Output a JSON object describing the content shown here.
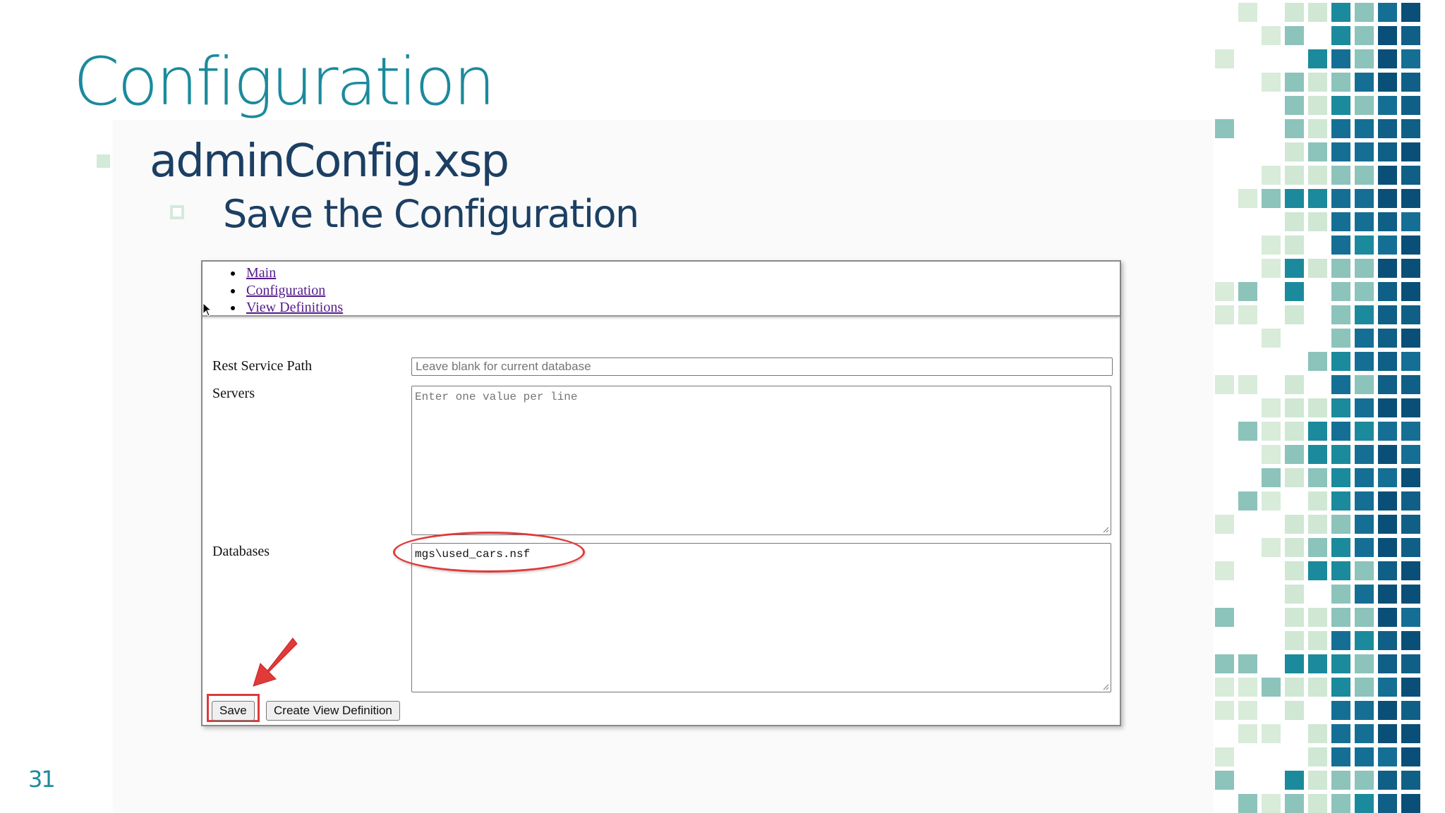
{
  "slide": {
    "title": "Configuration",
    "bullet1": "adminConfig.xsp",
    "bullet2": "Save the Configuration",
    "page_number": "31",
    "colors": {
      "title": "#1b8a9c",
      "text": "#1c3f63",
      "accent_light": "#d3ead9",
      "highlight": "#e03a3a"
    }
  },
  "nav": {
    "links": [
      "Main",
      "Configuration",
      "View Definitions"
    ]
  },
  "form": {
    "rest_service_path": {
      "label": "Rest Service Path",
      "placeholder": "Leave blank for current database",
      "value": ""
    },
    "servers": {
      "label": "Servers",
      "placeholder": "Enter one value per line",
      "value": ""
    },
    "databases": {
      "label": "Databases",
      "value": "mgs\\used_cars.nsf"
    }
  },
  "buttons": {
    "save": "Save",
    "create_view_definition": "Create View Definition"
  },
  "icons": {
    "cursor": "mouse-pointer-icon",
    "arrow": "red-arrow-annotation-icon"
  }
}
